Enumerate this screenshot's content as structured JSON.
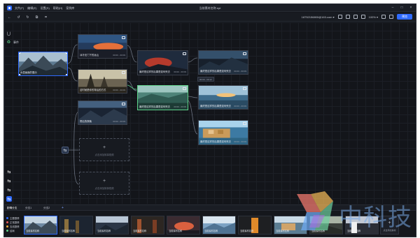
{
  "menubar": {
    "menus": [
      "文件(F)",
      "编辑(E)",
      "设置(S)",
      "帮助(H)",
      "案例库"
    ],
    "title": "当前素材名称.ept"
  },
  "toolbar": {
    "account": "18752156800@163.com ▾",
    "zoom": "100% ▾",
    "publish_label": "预览"
  },
  "side_tools": {
    "event_label": "事件"
  },
  "nodes": {
    "root": {
      "label": "水墨画面的展示"
    },
    "b1": {
      "label": "冰冷无门下的远山",
      "time": "00:00 - 00:09"
    },
    "b2": {
      "label": "这时就是你的背后的方式",
      "time": "00:00 - 00:09"
    },
    "b3": {
      "label": "雾后的夜晚",
      "time": "00:00 - 00:09"
    },
    "c1": {
      "label": "最终是这样的后果是如何死去",
      "time": "00:00 - 00:09"
    },
    "c2": {
      "label": "最终是这样的后果是如何死去",
      "time": "00:00 - 00:09"
    },
    "d1": {
      "label": "最终是这样的后果是如何死去",
      "time": "00:00 - 00:09"
    },
    "d2": {
      "label": "最终是这样的后果是如何死去",
      "time": "00:00 - 00:09"
    },
    "d3": {
      "label": "最终是这样的后果是如何死去",
      "time": "00:00 - 00:09"
    }
  },
  "connector_pill": "00:00 - 00:12",
  "empty_slots": [
    {
      "text": "点击添加故事视频"
    },
    {
      "text": "点击添加故事视频"
    }
  ],
  "scene_tabs": [
    "剧情分支",
    "分支1",
    "分支2"
  ],
  "legend": [
    {
      "label": "主要剧情",
      "color": "#2f6bff"
    },
    {
      "label": "正常剧情",
      "color": "#e85b5b"
    },
    {
      "label": "支线剧情",
      "color": "#f2a93b"
    },
    {
      "label": "结局",
      "color": "#5fd38a"
    }
  ],
  "strip_thumbs": [
    {
      "label": "当前素材名称"
    },
    {
      "label": "当前素材名称"
    },
    {
      "label": "当前素材名称"
    },
    {
      "label": "当前素材名称"
    },
    {
      "label": "当前素材名称"
    },
    {
      "label": "当前素材名称"
    },
    {
      "label": "当前素材名称"
    },
    {
      "label": "当前素材名称"
    },
    {
      "label": "当前素材名称"
    },
    {
      "label": "当前素材名称"
    }
  ],
  "add_scene": {
    "text": "点击添加素材"
  },
  "watermark": {
    "text": "中科技"
  }
}
